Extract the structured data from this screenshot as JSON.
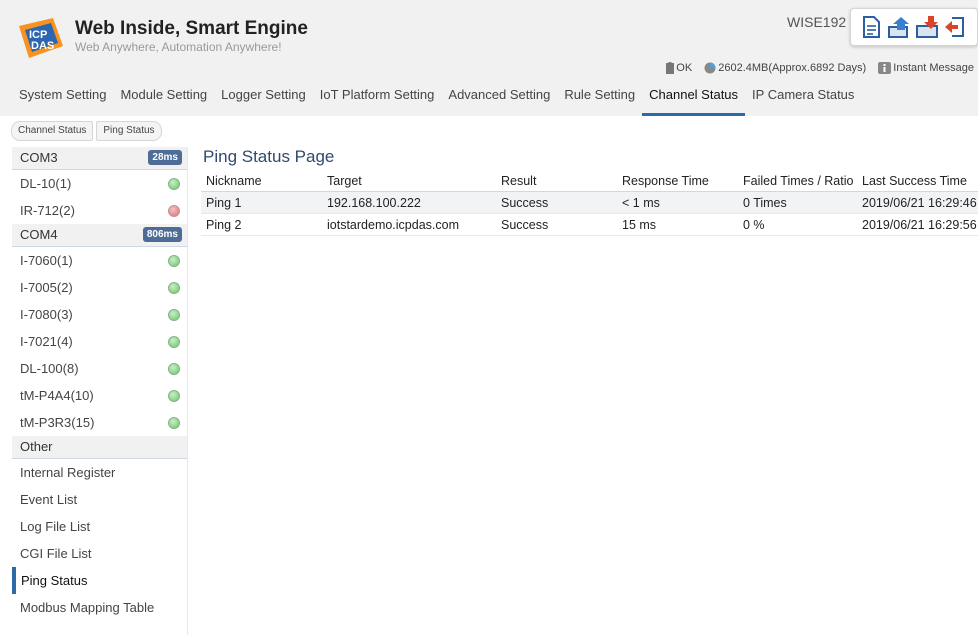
{
  "header": {
    "logo_text": "ICP DAS",
    "title": "Web Inside, Smart Engine",
    "subtitle": "Web Anywhere, Automation Anywhere!",
    "device_name": "WISE192",
    "toolbar": [
      "document-icon",
      "upload-icon",
      "download-icon",
      "logout-icon"
    ],
    "status": {
      "ok": "OK",
      "storage": "2602.4MB(Approx.6892 Days)",
      "message": "Instant Message"
    }
  },
  "nav": [
    {
      "label": "System Setting",
      "active": false
    },
    {
      "label": "Module Setting",
      "active": false
    },
    {
      "label": "Logger Setting",
      "active": false
    },
    {
      "label": "IoT Platform Setting",
      "active": false
    },
    {
      "label": "Advanced Setting",
      "active": false
    },
    {
      "label": "Rule Setting",
      "active": false
    },
    {
      "label": "Channel Status",
      "active": true
    },
    {
      "label": "IP Camera Status",
      "active": false
    }
  ],
  "breadcrumb": [
    "Channel Status",
    "Ping Status"
  ],
  "sidebar": {
    "com3": {
      "label": "COM3",
      "badge": "28ms"
    },
    "com3_items": [
      {
        "label": "DL-10(1)",
        "status": "green"
      },
      {
        "label": "IR-712(2)",
        "status": "red"
      }
    ],
    "com4": {
      "label": "COM4",
      "badge": "806ms"
    },
    "com4_items": [
      {
        "label": "I-7060(1)",
        "status": "green"
      },
      {
        "label": "I-7005(2)",
        "status": "green"
      },
      {
        "label": "I-7080(3)",
        "status": "green"
      },
      {
        "label": "I-7021(4)",
        "status": "green"
      },
      {
        "label": "DL-100(8)",
        "status": "green"
      },
      {
        "label": "tM-P4A4(10)",
        "status": "green"
      },
      {
        "label": "tM-P3R3(15)",
        "status": "green"
      }
    ],
    "other": {
      "label": "Other"
    },
    "other_items": [
      {
        "label": "Internal Register"
      },
      {
        "label": "Event List"
      },
      {
        "label": "Log File List"
      },
      {
        "label": "CGI File List"
      },
      {
        "label": "Ping Status",
        "selected": true
      },
      {
        "label": "Modbus Mapping Table"
      }
    ]
  },
  "main": {
    "title": "Ping Status Page",
    "columns": [
      "Nickname",
      "Target",
      "Result",
      "Response Time",
      "Failed Times / Ratio",
      "Last Success Time"
    ],
    "rows": [
      [
        "Ping 1",
        "192.168.100.222",
        "Success",
        "< 1 ms",
        "0 Times",
        "2019/06/21 16:29:46"
      ],
      [
        "Ping 2",
        "iotstardemo.icpdas.com",
        "Success",
        "15 ms",
        "0 %",
        "2019/06/21 16:29:56"
      ]
    ]
  },
  "colors": {
    "accent": "#2d6aa8",
    "badge": "#4d6d96",
    "header_bg": "#f1f1f1",
    "title": "#2e4a6e"
  }
}
